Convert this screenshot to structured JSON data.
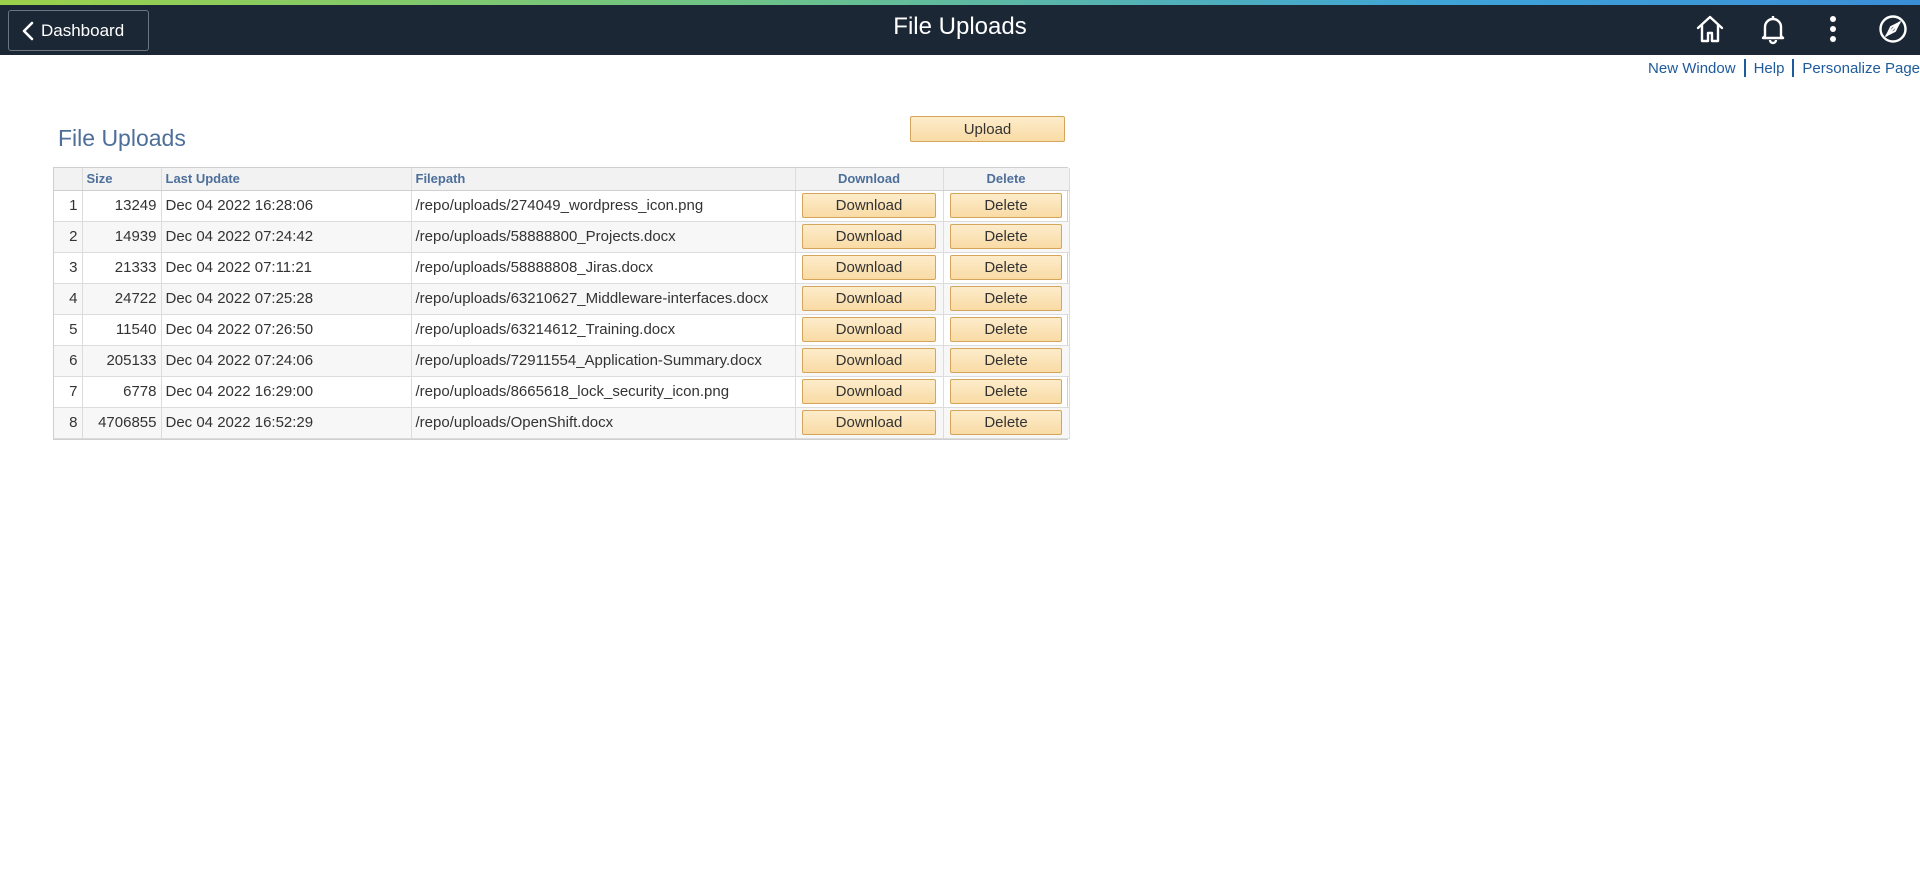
{
  "header": {
    "back_label": "Dashboard",
    "title": "File Uploads",
    "icons": [
      "home-icon",
      "bell-icon",
      "more-vertical-icon",
      "compass-icon"
    ]
  },
  "util_links": {
    "new_window": "New Window",
    "help": "Help",
    "personalize": "Personalize Page"
  },
  "section": {
    "title": "File Uploads",
    "upload_label": "Upload"
  },
  "grid": {
    "columns": {
      "num": "",
      "size": "Size",
      "last_update": "Last Update",
      "filepath": "Filepath",
      "download": "Download",
      "delete": "Delete"
    },
    "download_label": "Download",
    "delete_label": "Delete",
    "rows": [
      {
        "num": "1",
        "size": "13249",
        "last_update": "Dec 04 2022 16:28:06",
        "filepath": "/repo/uploads/274049_wordpress_icon.png"
      },
      {
        "num": "2",
        "size": "14939",
        "last_update": "Dec 04 2022 07:24:42",
        "filepath": "/repo/uploads/58888800_Projects.docx"
      },
      {
        "num": "3",
        "size": "21333",
        "last_update": "Dec 04 2022 07:11:21",
        "filepath": "/repo/uploads/58888808_Jiras.docx"
      },
      {
        "num": "4",
        "size": "24722",
        "last_update": "Dec 04 2022 07:25:28",
        "filepath": "/repo/uploads/63210627_Middleware-interfaces.docx"
      },
      {
        "num": "5",
        "size": "11540",
        "last_update": "Dec 04 2022 07:26:50",
        "filepath": "/repo/uploads/63214612_Training.docx"
      },
      {
        "num": "6",
        "size": "205133",
        "last_update": "Dec 04 2022 07:24:06",
        "filepath": "/repo/uploads/72911554_Application-Summary.docx"
      },
      {
        "num": "7",
        "size": "6778",
        "last_update": "Dec 04 2022 16:29:00",
        "filepath": "/repo/uploads/8665618_lock_security_icon.png"
      },
      {
        "num": "8",
        "size": "4706855",
        "last_update": "Dec 04 2022 16:52:29",
        "filepath": "/repo/uploads/OpenShift.docx"
      }
    ]
  }
}
